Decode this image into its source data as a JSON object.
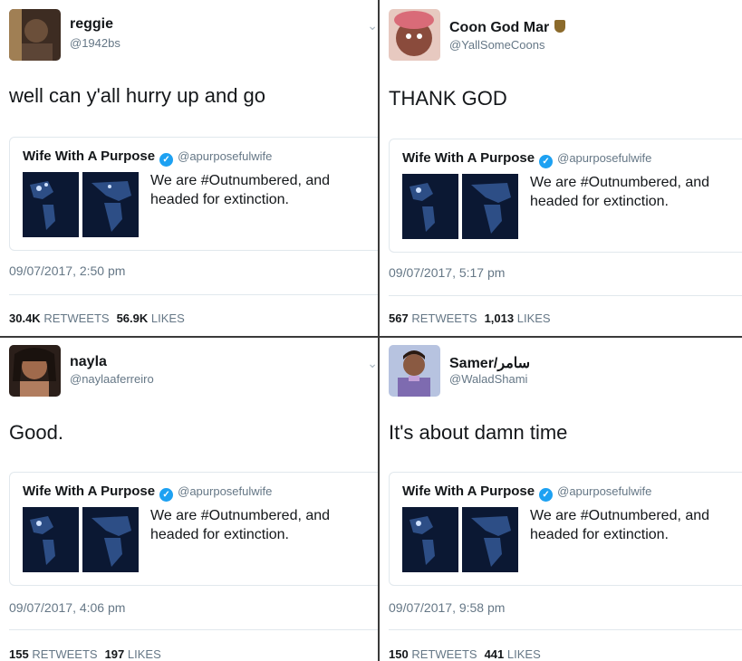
{
  "tweets": [
    {
      "name": "reggie",
      "handle": "@1942bs",
      "text": "well can y'all hurry up and go",
      "quote": {
        "name": "Wife With A Purpose",
        "handle": "@apurposefulwife",
        "text": "We are #Outnumbered, and headed for extinction."
      },
      "date": "09/07/2017, 2:50 pm",
      "retweets": "30.4K",
      "retweets_label": "RETWEETS",
      "likes": "56.9K",
      "likes_label": "LIKES",
      "avatar_color": "#6b4f3a"
    },
    {
      "name": "Coon God Mar",
      "handle": "@YallSomeCoons",
      "text": "THANK GOD",
      "quote": {
        "name": "Wife With A Purpose",
        "handle": "@apurposefulwife",
        "text": "We are #Outnumbered, and headed for extinction."
      },
      "date": "09/07/2017, 5:17 pm",
      "retweets": "567",
      "retweets_label": "RETWEETS",
      "likes": "1,013",
      "likes_label": "LIKES",
      "avatar_color": "#c9645a"
    },
    {
      "name": "nayla",
      "handle": "@naylaaferreiro",
      "text": "Good.",
      "quote": {
        "name": "Wife With A Purpose",
        "handle": "@apurposefulwife",
        "text": "We are #Outnumbered, and headed for extinction."
      },
      "date": "09/07/2017, 4:06 pm",
      "retweets": "155",
      "retweets_label": "RETWEETS",
      "likes": "197",
      "likes_label": "LIKES",
      "avatar_color": "#5a3b2e"
    },
    {
      "name": "Samer/سامر",
      "handle": "@WaladShami",
      "text": "It's about damn time",
      "quote": {
        "name": "Wife With A Purpose",
        "handle": "@apurposefulwife",
        "text": "We are #Outnumbered, and headed for extinction."
      },
      "date": "09/07/2017, 9:58 pm",
      "retweets": "150",
      "retweets_label": "RETWEETS",
      "likes": "441",
      "likes_label": "LIKES",
      "avatar_color": "#7a86a8"
    }
  ],
  "icons": {
    "verified": "verified-check-icon",
    "chevron": "chevron-down-icon"
  },
  "colors": {
    "verified": "#1da1f2",
    "muted": "#657786",
    "border": "#e1e8ed"
  }
}
